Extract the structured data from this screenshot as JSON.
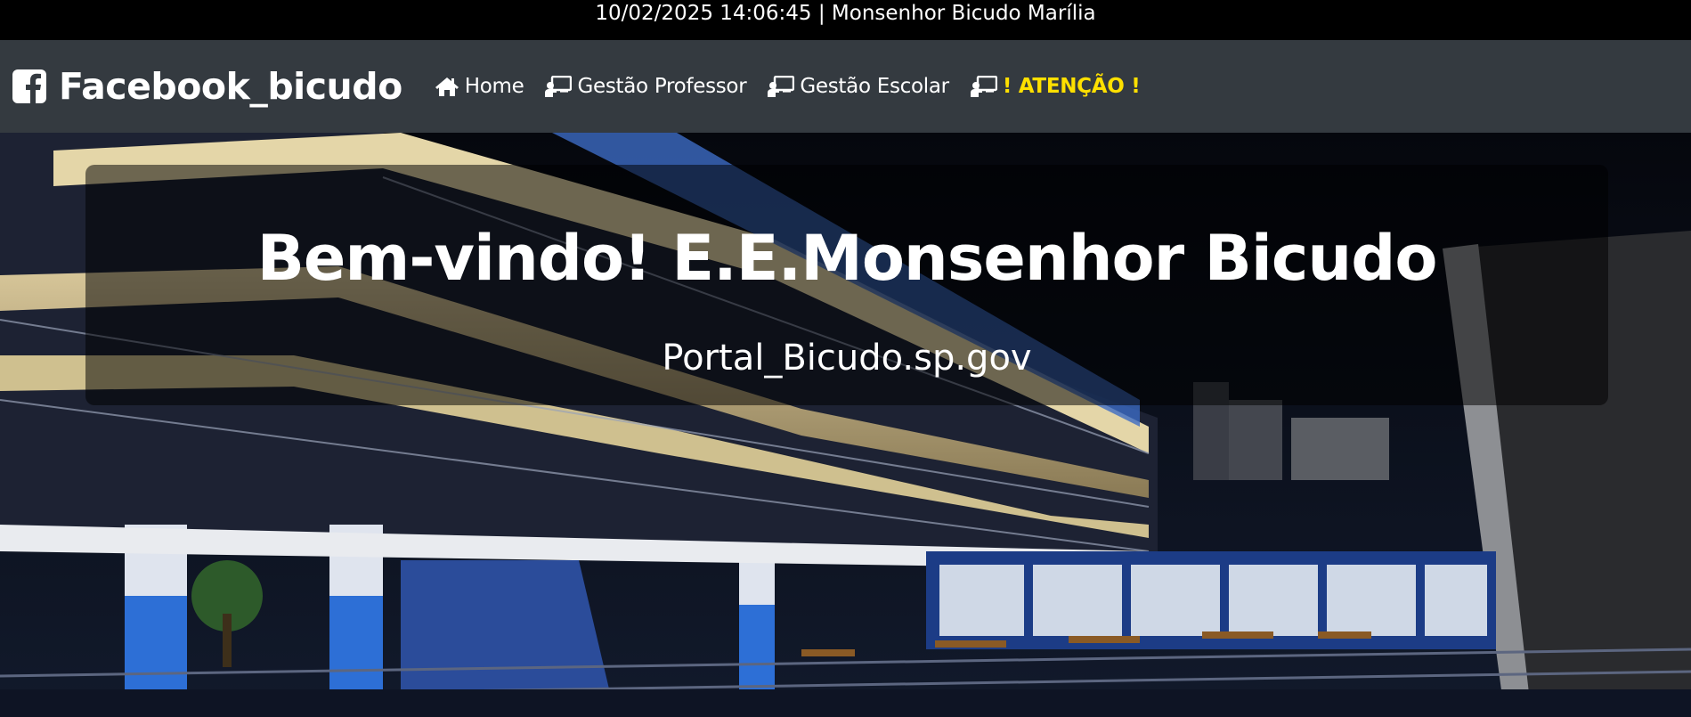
{
  "topbar": {
    "text": "10/02/2025 14:06:45 | Monsenhor Bicudo Marília"
  },
  "navbar": {
    "brand": {
      "icon": "facebook-square-icon",
      "label": "Facebook_bicudo"
    },
    "links": [
      {
        "icon": "home-icon",
        "label": "Home"
      },
      {
        "icon": "chalkboard-teacher-icon",
        "label": "Gestão Professor"
      },
      {
        "icon": "chalkboard-teacher-icon",
        "label": "Gestão Escolar"
      },
      {
        "icon": "chalkboard-teacher-icon",
        "label": "! ATENÇÃO !"
      }
    ]
  },
  "hero": {
    "title": "Bem-vindo! E.E.Monsenhor Bicudo",
    "subtitle": "Portal_Bicudo.sp.gov"
  },
  "colors": {
    "topbar_bg": "#000000",
    "navbar_bg": "#343a40",
    "alert_text": "#ffe000",
    "text": "#ffffff"
  }
}
